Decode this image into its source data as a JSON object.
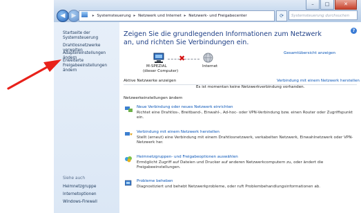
{
  "window": {
    "address": {
      "crumbs": [
        "Systemsteuerung",
        "Netzwerk und Internet",
        "Netzwerk- und Freigabecenter"
      ]
    },
    "search_placeholder": "Systemsteuerung durchsuchen",
    "controls": {
      "minimize": "–",
      "maximize": "□",
      "close": "✕"
    }
  },
  "sidebar": {
    "items": [
      {
        "label": "Startseite der Systemsteuerung"
      },
      {
        "label": "Drahtlosnetzwerke verwalten"
      },
      {
        "label": "Adaptereinstellungen ändern"
      },
      {
        "label": "Erweiterte Freigabeeinstellungen ändern"
      }
    ],
    "see_also": {
      "heading": "Siehe auch",
      "items": [
        {
          "label": "Heimnetzgruppe"
        },
        {
          "label": "Internetoptionen"
        },
        {
          "label": "Windows-Firewall"
        }
      ]
    }
  },
  "main": {
    "title": "Zeigen Sie die grundlegenden Informationen zum Netzwerk an, und richten Sie Verbindungen ein.",
    "full_map_link": "Gesamtübersicht anzeigen",
    "computer_name": "M-SPEZIAL",
    "computer_sub": "(dieser Computer)",
    "internet_label": "Internet",
    "active_networks_label": "Aktive Netzwerke anzeigen",
    "connect_link": "Verbindung mit einem Netzwerk herstellen",
    "no_network_text": "Es ist momentan keine Netzwerkverbindung vorhanden.",
    "settings_heading": "Netzwerkeinstellungen ändern",
    "tasks": [
      {
        "title": "Neue Verbindung oder neues Netzwerk einrichten",
        "desc": "Richtet eine Drahtlos-, Breitband-, Einwahl-, Ad-hoc- oder VPN-Verbindung bzw. einen Router oder Zugriffspunkt ein.",
        "icon": "network-setup-icon"
      },
      {
        "title": "Verbindung mit einem Netzwerk herstellen",
        "desc": "Stellt (erneut) eine Verbindung mit einem Drahtlosnetzwerk, verkabelten Netzwerk, Einwahlnetzwerk oder VPN-Netzwerk her.",
        "icon": "network-connect-icon"
      },
      {
        "title": "Heimnetzgruppen- und Freigabeoptionen auswählen",
        "desc": "Ermöglicht Zugriff auf Dateien und Drucker auf anderen Netzwerkcomputern zu, oder ändert die Freigabeeinstellungen.",
        "icon": "homegroup-icon"
      },
      {
        "title": "Probleme beheben",
        "desc": "Diagnostiziert und behebt Netzwerkprobleme, oder ruft Problembehandlungsinformationen ab.",
        "icon": "troubleshoot-icon"
      }
    ]
  },
  "colors": {
    "annotation_arrow": "#e8211a",
    "link": "#0a56b8",
    "title": "#1e3f86"
  }
}
